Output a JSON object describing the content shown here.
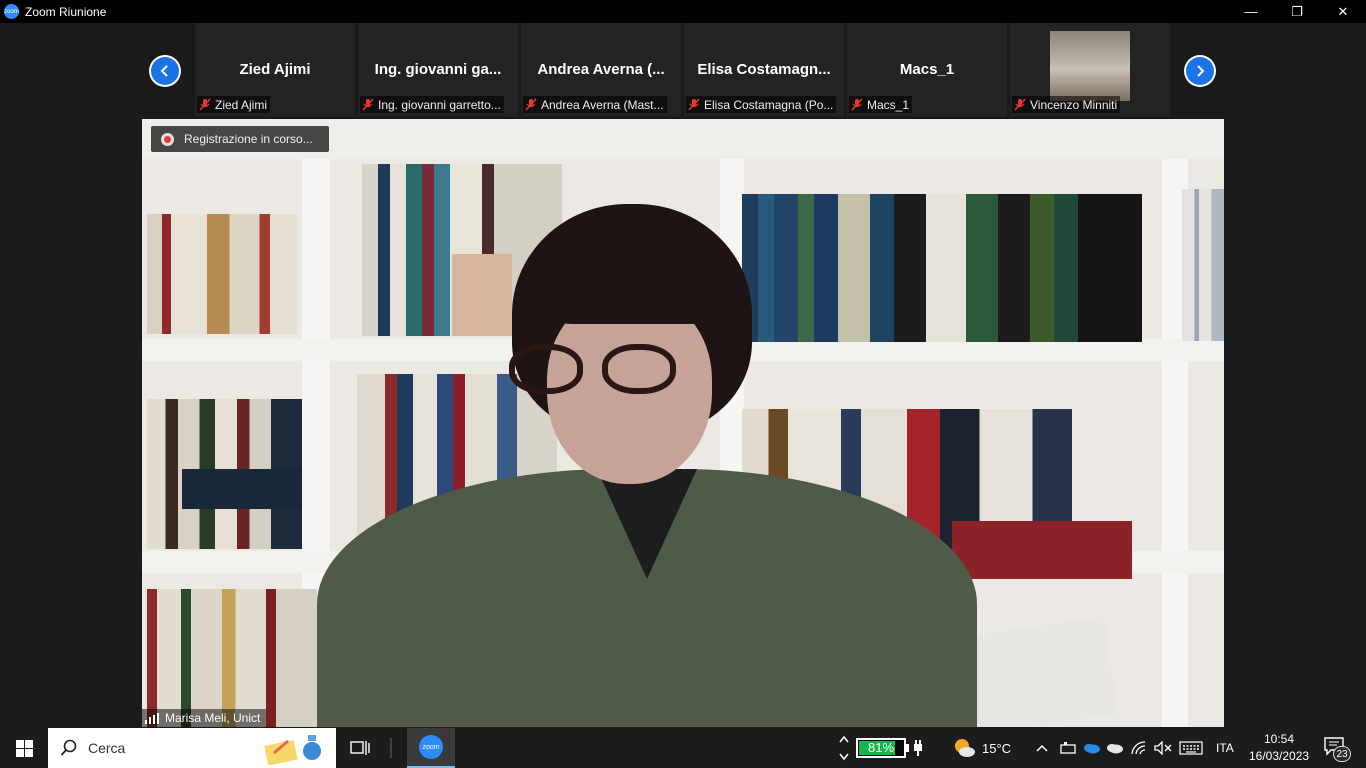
{
  "window": {
    "title": "Zoom Riunione",
    "app_icon_text": "zoom",
    "minimize_glyph": "—",
    "restore_glyph": "❐",
    "close_glyph": "✕"
  },
  "gallery": {
    "tiles": [
      {
        "display_name": "Zied Ajimi",
        "label": "Zied Ajimi",
        "muted": true
      },
      {
        "display_name": "Ing. giovanni ga...",
        "label": "Ing. giovanni garretto...",
        "muted": true
      },
      {
        "display_name": "Andrea Averna (...",
        "label": "Andrea Averna (Mast...",
        "muted": true
      },
      {
        "display_name": "Elisa Costamagn...",
        "label": "Elisa Costamagna (Po...",
        "muted": true
      },
      {
        "display_name": "Macs_1",
        "label": "Macs_1",
        "muted": true
      },
      {
        "display_name": "",
        "label": "Vincenzo Minniti",
        "muted": true,
        "has_video": true
      }
    ]
  },
  "main": {
    "recording_text": "Registrazione in corso...",
    "speaker_name": "Marisa Meli, Unict"
  },
  "taskbar": {
    "search_placeholder": "Cerca",
    "zoom_label": "zoom",
    "battery_percent": "81%",
    "battery_level": 0.81,
    "weather": "15°C",
    "language": "ITA",
    "time": "10:54",
    "date": "16/03/2023",
    "notifications": "23"
  },
  "colors": {
    "zoom_blue": "#2d8cff",
    "nav_blue": "#1a73e8",
    "mic_muted_red": "#e53935",
    "battery_green": "#12b84a"
  }
}
